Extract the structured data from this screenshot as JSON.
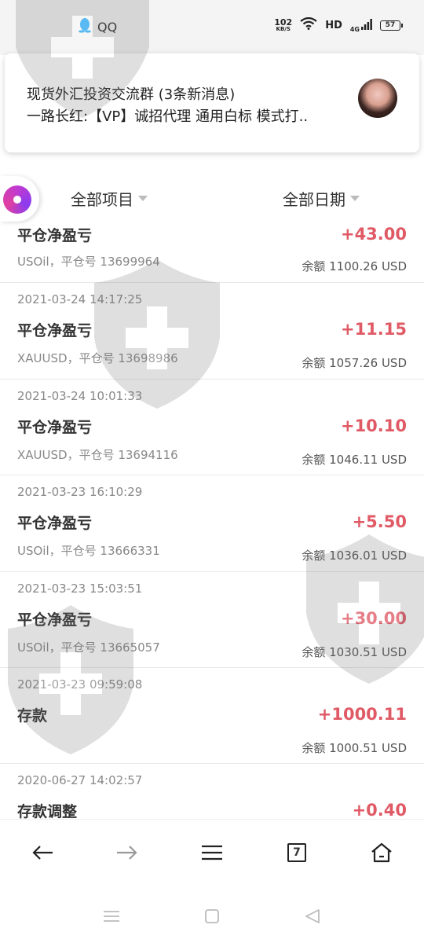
{
  "status_bar": {
    "app_name": "QQ",
    "net_speed_value": "102",
    "net_speed_unit": "KB/S",
    "hd_label": "HD",
    "signal_label": "4G",
    "battery": "57"
  },
  "notification": {
    "title": "现货外汇投资交流群 (3条新消息)",
    "body": "一路长红:【VP】诚招代理 通用白标 模式打.."
  },
  "filters": {
    "project": "全部项目",
    "date": "全部日期"
  },
  "records": [
    {
      "timestamp": "",
      "title": "平仓净盈亏",
      "detail": "USOil，平仓号 13699964",
      "amount": "+43.00",
      "balance": "余额 1100.26 USD"
    },
    {
      "timestamp": "2021-03-24 14:17:25",
      "title": "平仓净盈亏",
      "detail": "XAUUSD，平仓号 13698986",
      "amount": "+11.15",
      "balance": "余额 1057.26 USD"
    },
    {
      "timestamp": "2021-03-24 10:01:33",
      "title": "平仓净盈亏",
      "detail": "XAUUSD，平仓号 13694116",
      "amount": "+10.10",
      "balance": "余额 1046.11 USD"
    },
    {
      "timestamp": "2021-03-23 16:10:29",
      "title": "平仓净盈亏",
      "detail": "USOil，平仓号 13666331",
      "amount": "+5.50",
      "balance": "余额 1036.01 USD"
    },
    {
      "timestamp": "2021-03-23 15:03:51",
      "title": "平仓净盈亏",
      "detail": "USOil，平仓号 13665057",
      "amount": "+30.00",
      "balance": "余额 1030.51 USD"
    },
    {
      "timestamp": "2021-03-23 09:59:08",
      "title": "存款",
      "detail": "",
      "amount": "+1000.11",
      "balance": "余额 1000.51 USD"
    },
    {
      "timestamp": "2020-06-27 14:02:57",
      "title": "存款调整",
      "detail": "",
      "amount": "+0.40",
      "balance": ""
    }
  ],
  "toolbar": {
    "tab_count": "7",
    "icons": [
      "back-arrow-icon",
      "forward-arrow-icon",
      "menu-icon",
      "tabs-icon",
      "home-icon"
    ]
  },
  "colors": {
    "amount_positive": "#e05a66",
    "watermark": "#9a9a9a"
  }
}
